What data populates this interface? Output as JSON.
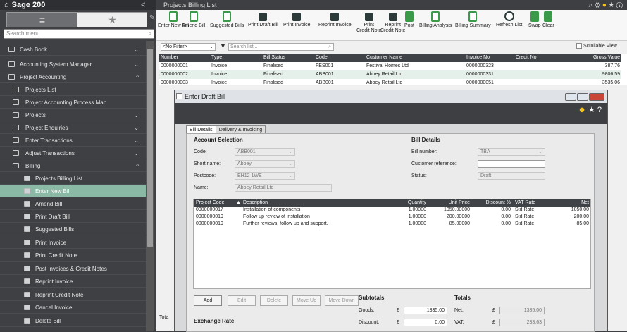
{
  "app": {
    "title": "Sage 200",
    "collapse": "<"
  },
  "sidebar": {
    "search_placeholder": "Search menu...",
    "items": [
      {
        "label": "Cash Book",
        "chev": "⌄"
      },
      {
        "label": "Accounting System Manager",
        "chev": "⌄"
      },
      {
        "label": "Project Accounting",
        "chev": "^"
      },
      {
        "label": "Projects List"
      },
      {
        "label": "Project Accounting Process Map"
      },
      {
        "label": "Projects",
        "chev": "⌄"
      },
      {
        "label": "Project Enquiries",
        "chev": "⌄"
      },
      {
        "label": "Enter Transactions",
        "chev": "⌄"
      },
      {
        "label": "Adjust Transactions",
        "chev": "⌄"
      },
      {
        "label": "Billing",
        "chev": "^"
      },
      {
        "label": "Projects Billing List"
      },
      {
        "label": "Enter New Bill"
      },
      {
        "label": "Amend Bill"
      },
      {
        "label": "Print Draft Bill"
      },
      {
        "label": "Suggested Bills"
      },
      {
        "label": "Print Invoice"
      },
      {
        "label": "Print Credit Note"
      },
      {
        "label": "Post Invoices & Credit Notes"
      },
      {
        "label": "Reprint Invoice"
      },
      {
        "label": "Reprint Credit Note"
      },
      {
        "label": "Cancel Invoice"
      },
      {
        "label": "Delete Bill"
      }
    ]
  },
  "window_title": "Projects Billing List",
  "toolbar": {
    "items": [
      {
        "label": "Enter New Bill",
        "icon": "doc"
      },
      {
        "label": "Amend Bill",
        "icon": "doc"
      },
      {
        "label": "Suggested Bills",
        "icon": "doc"
      },
      {
        "label": "Print Draft Bill",
        "icon": "print"
      },
      {
        "label": "Print Invoice",
        "icon": "print"
      },
      {
        "label": "Reprint Invoice",
        "icon": "print"
      },
      {
        "label": "Print\nCredit Note",
        "icon": "print"
      },
      {
        "label": "Reprint\nCredit Note",
        "icon": "print"
      },
      {
        "label": "Post",
        "icon": "green"
      },
      {
        "label": "Billing Analysis",
        "icon": "doc"
      },
      {
        "label": "Billing Summary",
        "icon": "doc"
      },
      {
        "label": "Refresh List",
        "icon": "refresh"
      },
      {
        "label": "Swap",
        "icon": "green"
      },
      {
        "label": "Clear",
        "icon": "green"
      }
    ]
  },
  "filter": {
    "value": "<No Filter>",
    "search_placeholder": "Search list...",
    "scrollable_label": "Scrollable View"
  },
  "grid": {
    "headers": [
      "Number",
      "Type",
      "Bill Status",
      "Code",
      "Customer Name",
      "Invoice No",
      "Credit No",
      "Gross Value"
    ],
    "rows": [
      [
        "0000000001",
        "Invoice",
        "Finalised",
        "FES001",
        "Festival Homes Ltd",
        "0000000323",
        "",
        "387.76"
      ],
      [
        "0000000002",
        "Invoice",
        "Finalised",
        "ABB001",
        "Abbey Retail Ltd",
        "0000000331",
        "",
        "9806.59"
      ],
      [
        "0000000003",
        "Invoice",
        "Finalised",
        "ABB001",
        "Abbey Retail Ltd",
        "0000000051",
        "",
        "3535.06"
      ]
    ],
    "footer": "Tota"
  },
  "dialog": {
    "title": "Enter Draft Bill",
    "tabs": [
      "Bill Details",
      "Delivery & Invoicing"
    ],
    "account_section": "Account Selection",
    "code_label": "Code:",
    "code_value": "ABB001",
    "short_label": "Short name:",
    "short_value": "Abbey",
    "postcode_label": "Postcode:",
    "postcode_value": "EH12 1WE",
    "name_label": "Name:",
    "name_value": "Abbey Retail Ltd",
    "bill_section": "Bill Details",
    "billno_label": "Bill number:",
    "billno_value": "TBA",
    "custref_label": "Customer reference:",
    "custref_value": "",
    "status_label": "Status:",
    "status_value": "Draft",
    "line_headers": [
      "Project Code",
      "Description",
      "Quantity",
      "Unit Price",
      "Discount %",
      "VAT Rate",
      "Net"
    ],
    "sort_icon": "▲",
    "lines": [
      [
        "0000000017",
        "Installation of components",
        "1.00000",
        "1050.00000",
        "0.00",
        "Std Rate",
        "1050.00"
      ],
      [
        "0000000019",
        "Follow up review of installation",
        "1.00000",
        "200.00000",
        "0.00",
        "Std Rate",
        "200.00"
      ],
      [
        "0000000019",
        "Further reviews, follow up and support.",
        "1.00000",
        "85.00000",
        "0.00",
        "Std Rate",
        "85.00"
      ]
    ],
    "buttons": [
      "Add",
      "Edit",
      "Delete",
      "Move Up",
      "Move Down"
    ],
    "subtotals_label": "Subtotals",
    "totals_label": "Totals",
    "goods_label": "Goods:",
    "goods_value": "1335.00",
    "net_label": "Net:",
    "net_value": "1335.00",
    "discount_label": "Discount:",
    "discount_value": "0.00",
    "vat_label": "VAT:",
    "vat_value": "233.63",
    "currency": "£",
    "exchange_label": "Exchange Rate"
  }
}
